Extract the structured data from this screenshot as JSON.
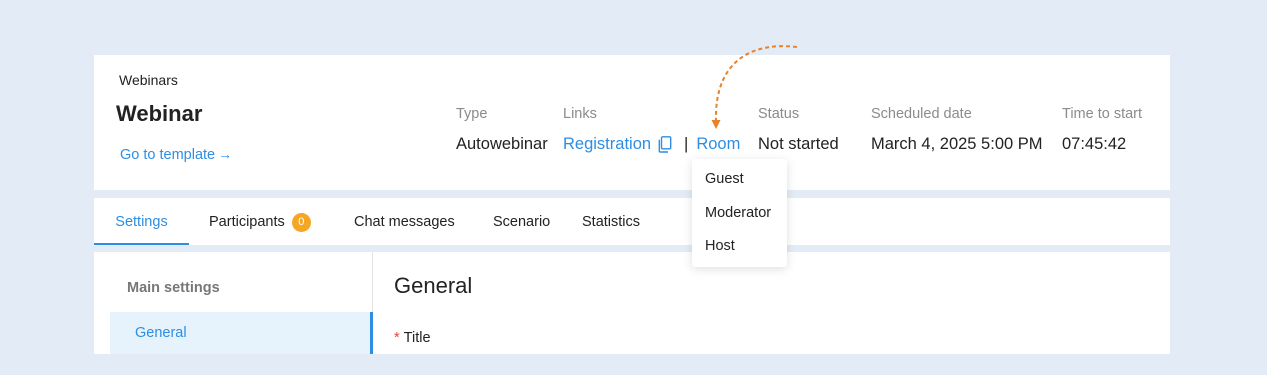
{
  "header": {
    "breadcrumb": "Webinars",
    "title": "Webinar",
    "template_link": "Go to template",
    "template_link_arrow": "→",
    "type": {
      "label": "Type",
      "value": "Autowebinar"
    },
    "links": {
      "label": "Links",
      "registration": "Registration",
      "separator": "|",
      "room": "Room"
    },
    "status": {
      "label": "Status",
      "value": "Not started"
    },
    "scheduled": {
      "label": "Scheduled date",
      "value": "March 4, 2025 5:00 PM"
    },
    "time_to_start": {
      "label": "Time to start",
      "value": "07:45:42"
    }
  },
  "room_dropdown": {
    "items": [
      "Guest",
      "Moderator",
      "Host"
    ]
  },
  "tabs": [
    {
      "label": "Settings",
      "active": true
    },
    {
      "label": "Participants",
      "badge": "0"
    },
    {
      "label": "Chat messages"
    },
    {
      "label": "Scenario"
    },
    {
      "label": "Statistics"
    }
  ],
  "sidebar": {
    "heading": "Main settings",
    "active_item": "General"
  },
  "main": {
    "section_title": "General",
    "required_mark": "*",
    "field_label": "Title"
  },
  "colors": {
    "accent": "#2d8ee3",
    "badge": "#f5a623",
    "annotation_arrow": "#e8822a",
    "background": "#e3ecf6"
  },
  "icons": {
    "copy": "copy-icon",
    "arrow": "arrow-right-icon"
  }
}
